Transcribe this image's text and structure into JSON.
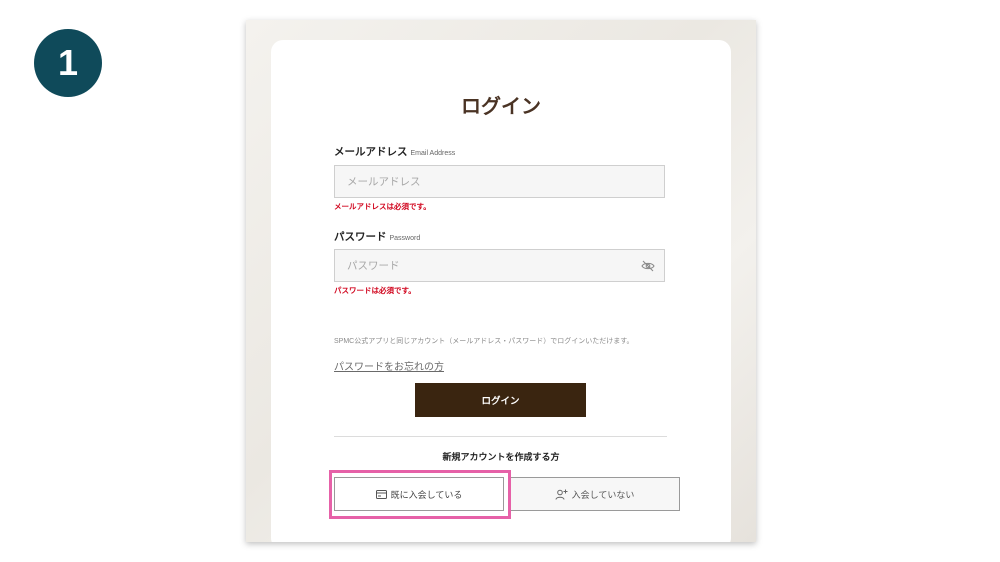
{
  "step": {
    "number": "1"
  },
  "login": {
    "title": "ログイン",
    "email": {
      "label": "メールアドレス",
      "label_en": "Email Address",
      "placeholder": "メールアドレス",
      "value": "",
      "error": "メールアドレスは必須です。"
    },
    "password": {
      "label": "パスワード",
      "label_en": "Password",
      "placeholder": "パスワード",
      "value": "",
      "error": "パスワードは必須です。",
      "toggle_icon": "eye-slash-icon"
    },
    "note": "SPMC公式アプリと同じアカウント（メールアドレス・パスワード）でログインいただけます。",
    "forgot_link": "パスワードをお忘れの方",
    "submit_label": "ログイン"
  },
  "new_account": {
    "heading": "新規アカウントを作成する方",
    "member_button": {
      "label": "既に入会している",
      "icon": "card-icon"
    },
    "nonmember_button": {
      "label": "入会していない",
      "icon": "user-plus-icon"
    }
  },
  "colors": {
    "step_badge": "#0f4a5a",
    "title": "#4a3324",
    "login_button": "#3a2510",
    "error": "#d0021b",
    "highlight": "#e661a8"
  }
}
